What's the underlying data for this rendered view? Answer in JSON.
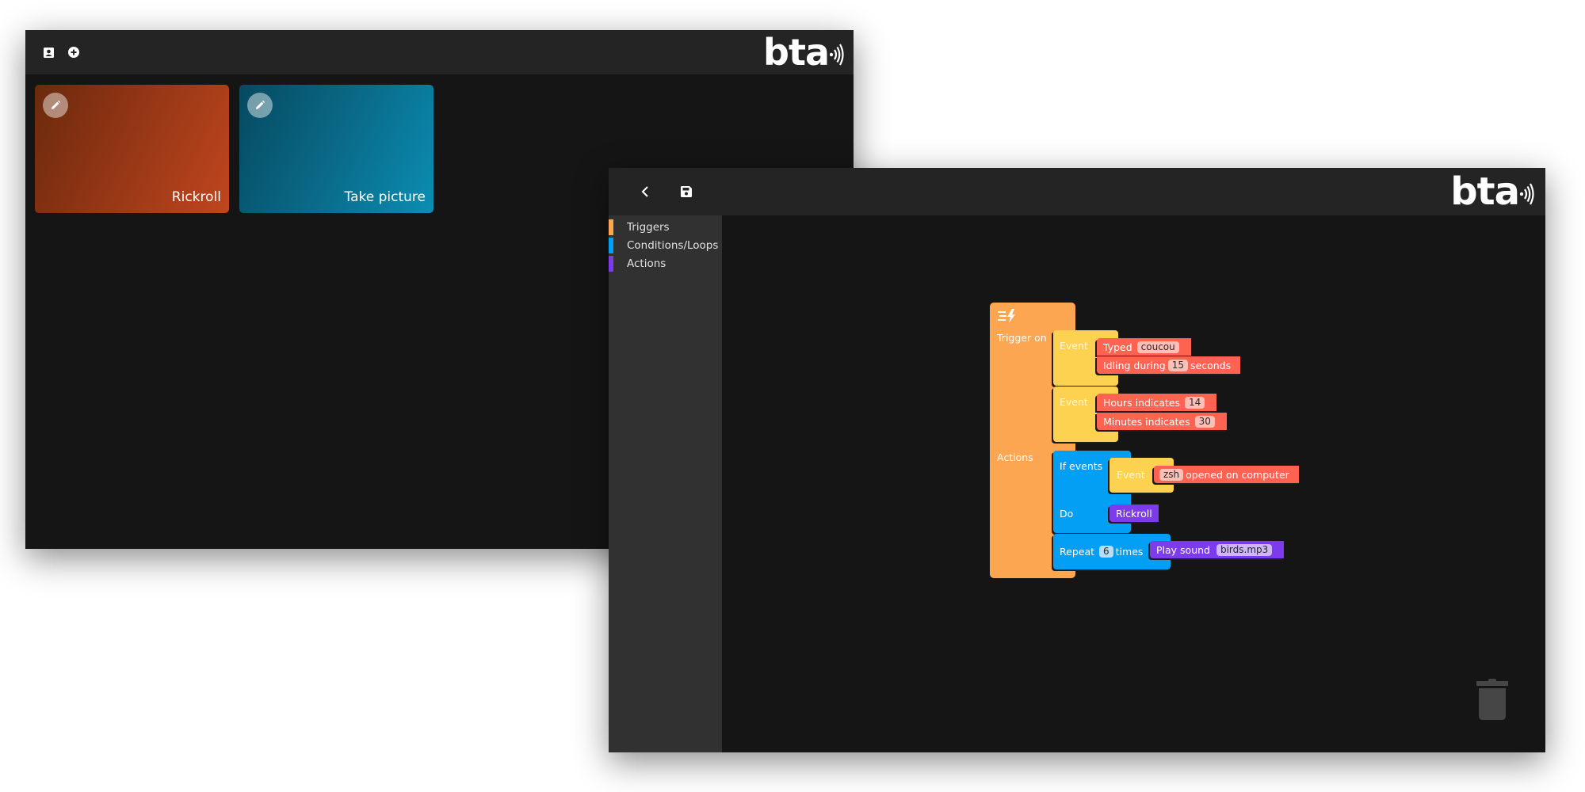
{
  "dashboard": {
    "toolbar": {
      "icons": [
        "contact-card-icon",
        "add-circle-icon"
      ]
    },
    "logo": "bta",
    "cards": [
      {
        "title": "Rickroll",
        "color_from": "#6b2a0d",
        "color_to": "#c0461e",
        "edit_icon": "pencil-icon"
      },
      {
        "title": "Take picture",
        "color_from": "#054a60",
        "color_to": "#0b8db3",
        "edit_icon": "pencil-icon"
      }
    ]
  },
  "editor": {
    "toolbar": {
      "back_icon": "chevron-left-icon",
      "save_icon": "floppy-disk-icon"
    },
    "logo": "bta",
    "categories": [
      {
        "label": "Triggers",
        "color": "#fda651"
      },
      {
        "label": "Conditions/Loops",
        "color": "#039ff5"
      },
      {
        "label": "Actions",
        "color": "#7c3bed"
      }
    ],
    "workspace": {
      "trigger_block": {
        "icon": "trigger-lightning-icon",
        "trigger_label": "Trigger on",
        "actions_label": "Actions"
      },
      "events": [
        {
          "label": "Event",
          "conditions": [
            {
              "prefix": "Typed",
              "value": "coucou",
              "suffix": ""
            },
            {
              "prefix": "Idling during",
              "value": "15",
              "suffix": "seconds"
            }
          ]
        },
        {
          "label": "Event",
          "conditions": [
            {
              "prefix": "Hours indicates",
              "value": "14",
              "suffix": ""
            },
            {
              "prefix": "Minutes indicates",
              "value": "30",
              "suffix": ""
            }
          ]
        }
      ],
      "if_block": {
        "if_label": "If events",
        "event_label": "Event",
        "condition": {
          "value": "zsh",
          "suffix": "opened on computer"
        },
        "do_label": "Do",
        "do_action": "Rickroll"
      },
      "repeat_block": {
        "prefix": "Repeat",
        "count": "6",
        "suffix": "times",
        "action": {
          "prefix": "Play sound",
          "value": "birds.mp3"
        }
      }
    },
    "trash_icon": "trash-can-icon"
  },
  "colors": {
    "trigger": "#fda651",
    "event": "#fdd251",
    "condition": "#fe6250",
    "control": "#039ff5",
    "action": "#7c3bed"
  }
}
